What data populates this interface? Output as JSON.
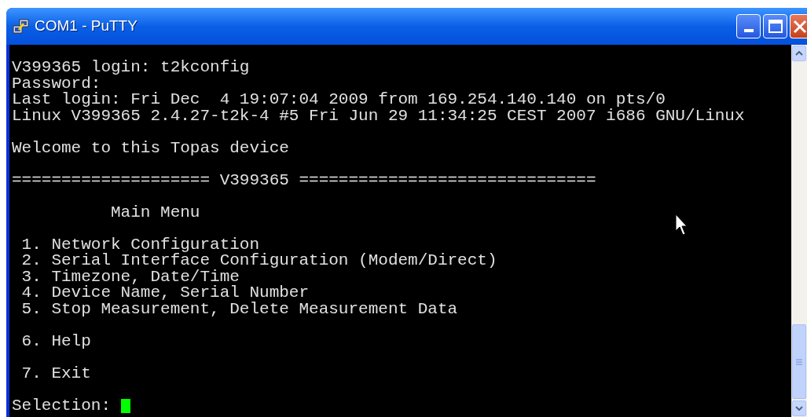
{
  "window": {
    "title": "COM1 - PuTTY"
  },
  "terminal": {
    "sections": [
      {
        "lines": [
          "V399365 login: t2kconfig",
          "Password:",
          "Last login: Fri Dec  4 19:07:04 2009 from 169.254.140.140 on pts/0",
          "Linux V399365 2.4.27-t2k-4 #5 Fri Jun 29 11:34:25 CEST 2007 i686 GNU/Linux"
        ]
      },
      {
        "lines": [
          "Welcome to this Topas device"
        ]
      },
      {
        "lines": [
          "==================== V399365 =============================="
        ]
      },
      {
        "lines": [
          "          Main Menu"
        ]
      },
      {
        "lines": [
          " 1. Network Configuration",
          " 2. Serial Interface Configuration (Modem/Direct)",
          " 3. Timezone, Date/Time",
          " 4. Device Name, Serial Number",
          " 5. Stop Measurement, Delete Measurement Data"
        ]
      },
      {
        "lines": [
          " 6. Help"
        ]
      },
      {
        "lines": [
          " 7. Exit"
        ]
      }
    ],
    "prompt": "Selection: ",
    "cursor": true
  }
}
